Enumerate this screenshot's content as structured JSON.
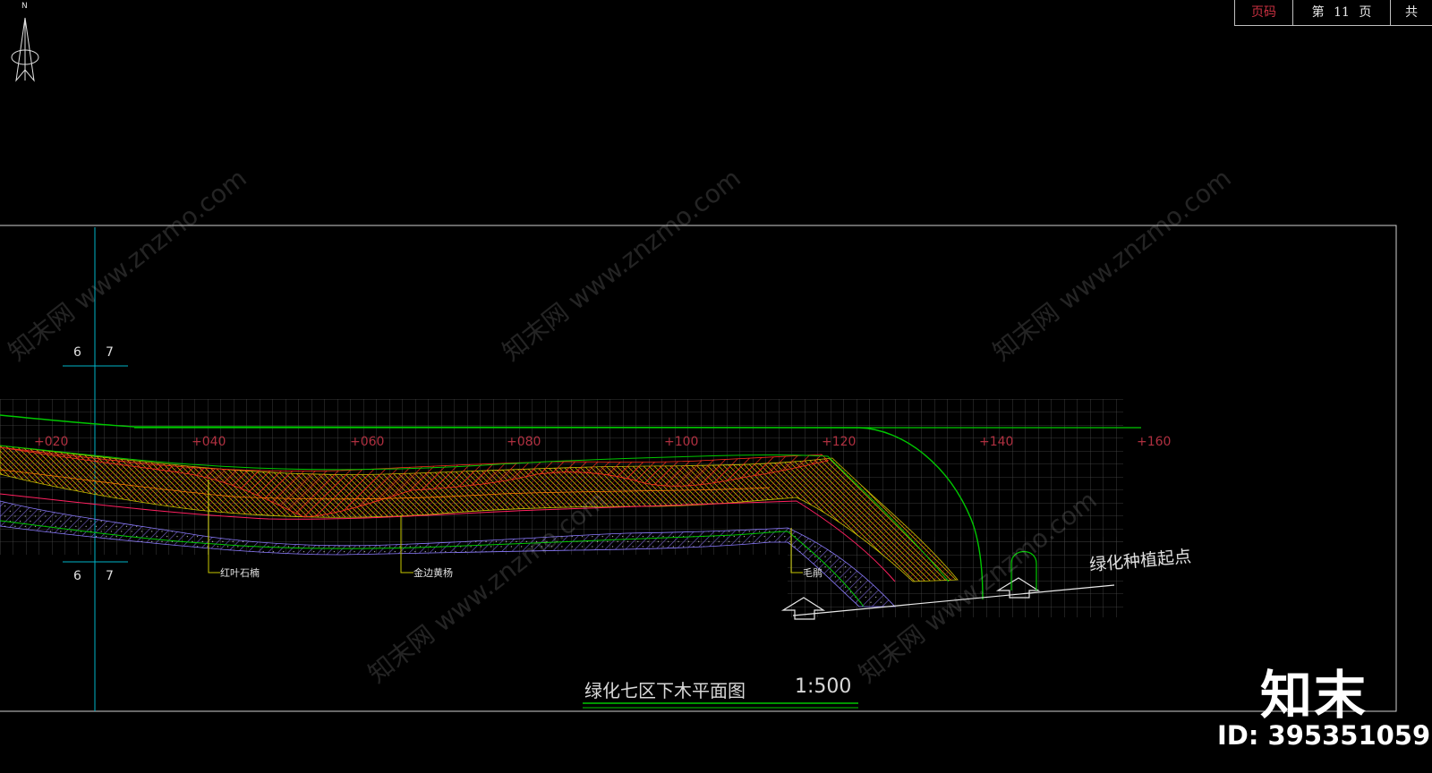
{
  "title_block": {
    "page_code_label": "页码",
    "page_label_prefix": "第",
    "page_number": "11",
    "page_label_suffix": "页",
    "total_label": "共"
  },
  "north_arrow_label": "N",
  "section_marks": {
    "top_left": "6",
    "top_right": "7",
    "bottom_left": "6",
    "bottom_right": "7"
  },
  "stations": [
    "+020",
    "+040",
    "+060",
    "+080",
    "+100",
    "+120",
    "+140",
    "+160"
  ],
  "plant_labels": {
    "photinia": "红叶石楠",
    "golden_privet": "金边黄杨",
    "azalea": "毛鹃"
  },
  "start_point_label": "绿化种植起点",
  "drawing_title": "绿化七区下木平面图",
  "scale": "1:500",
  "watermark": {
    "text": "知末网 www.znzmo.com",
    "logo": "知末",
    "id": "ID: 395351059"
  },
  "colors": {
    "background": "#000000",
    "grid": "#5a5a5a",
    "green_line": "#00c800",
    "red_hatch": "#ff3020",
    "purple_hatch": "#7060c0",
    "yellow_hatch": "#c8c000",
    "station_text": "#b03040",
    "cyan_line": "#00b4c8"
  }
}
